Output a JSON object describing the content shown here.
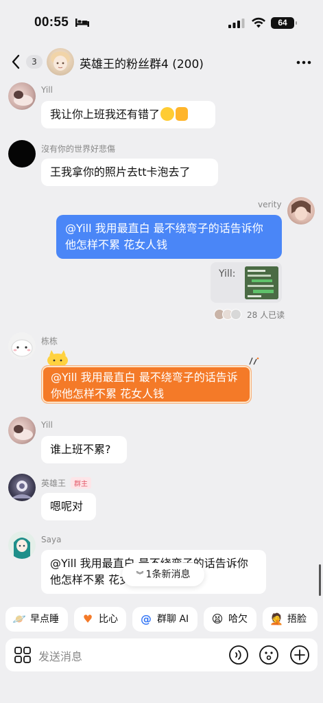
{
  "status": {
    "time": "00:55",
    "battery": "64"
  },
  "nav": {
    "unread_count": "3",
    "title": "英雄王的粉丝群4 (200)"
  },
  "messages": {
    "m1": {
      "sender": "Yill",
      "text": "我让你上班我还有错了"
    },
    "m2": {
      "sender": "沒有你的世界好悲傷",
      "text": "王我拿你的照片去tt卡泡去了"
    },
    "m3": {
      "sender": "verity",
      "text": "@Yill 我用最直白 最不绕弯子的话告诉你他怎样不累 花女人钱",
      "image_label": "Yill:",
      "read_text": "28 人已读"
    },
    "m4": {
      "sender": "栋栋",
      "text": "@Yill 我用最直白 最不绕弯子的话告诉你他怎样不累 花女人钱"
    },
    "m5": {
      "sender": "Yill",
      "text": "谁上班不累?"
    },
    "m6": {
      "sender": "英雄王",
      "tag": "群主",
      "text": "嗯呢对"
    },
    "m7": {
      "sender": "Saya",
      "text": "@Yill 我用最直白 最不绕弯子的话告诉你他怎样不累 花女人钱"
    }
  },
  "new_messages": "1条新消息",
  "chips": [
    {
      "icon": "planet-emoji",
      "label": "早点睡"
    },
    {
      "icon": "heart-hands-emoji",
      "label": "比心"
    },
    {
      "icon": "at-icon",
      "label": "群聊 AI"
    },
    {
      "icon": "yawn-emoji",
      "label": "哈欠"
    },
    {
      "icon": "facepalm-emoji",
      "label": "捂脸"
    }
  ],
  "input": {
    "placeholder": "发送消息"
  },
  "colors": {
    "background": "#efeff1",
    "self_bubble": "#4a86f7",
    "highlight_bubble": "#f47a28",
    "owner_tag": "#e35a6a"
  }
}
